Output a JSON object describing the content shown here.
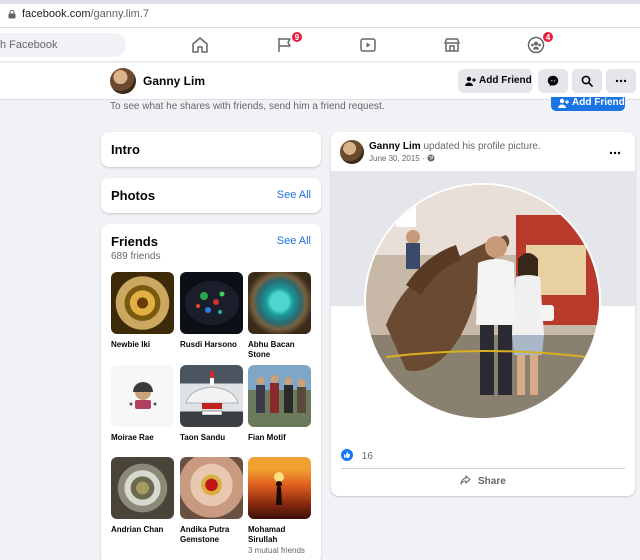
{
  "browser": {
    "url_host": "facebook.com",
    "url_path": "/ganny.lim.7"
  },
  "nav": {
    "search_placeholder": "h Facebook",
    "friend_requests_badge": "9",
    "groups_badge": "4"
  },
  "profile_header": {
    "name": "Ganny Lim",
    "add_friend_label": "Add Friend",
    "hint_text": "To see what he shares with friends, send him a friend request.",
    "add_friend_blue_label": "Add Friend"
  },
  "intro": {
    "title": "Intro"
  },
  "photos": {
    "title": "Photos",
    "see_all": "See All"
  },
  "friends": {
    "title": "Friends",
    "see_all": "See All",
    "count_text": "689 friends",
    "items": [
      {
        "name": "Newbie Iki",
        "mutual": ""
      },
      {
        "name": "Rusdi Harsono",
        "mutual": ""
      },
      {
        "name": "Abhu Bacan Stone",
        "mutual": ""
      },
      {
        "name": "Moirae Rae",
        "mutual": ""
      },
      {
        "name": "Taon Sandu",
        "mutual": ""
      },
      {
        "name": "Fian Motif",
        "mutual": ""
      },
      {
        "name": "Andrian Chan",
        "mutual": ""
      },
      {
        "name": "Andika Putra Gemstone",
        "mutual": ""
      },
      {
        "name": "Mohamad Sirullah",
        "mutual": "3 mutual friends"
      }
    ]
  },
  "post": {
    "author": "Ganny Lim",
    "action": "updated his profile picture.",
    "date": "June 30, 2015 ·",
    "likes": "16",
    "share_label": "Share"
  },
  "colors": {
    "accent": "#1b74e4",
    "badge": "#e41e3f",
    "link": "#216fdb"
  }
}
